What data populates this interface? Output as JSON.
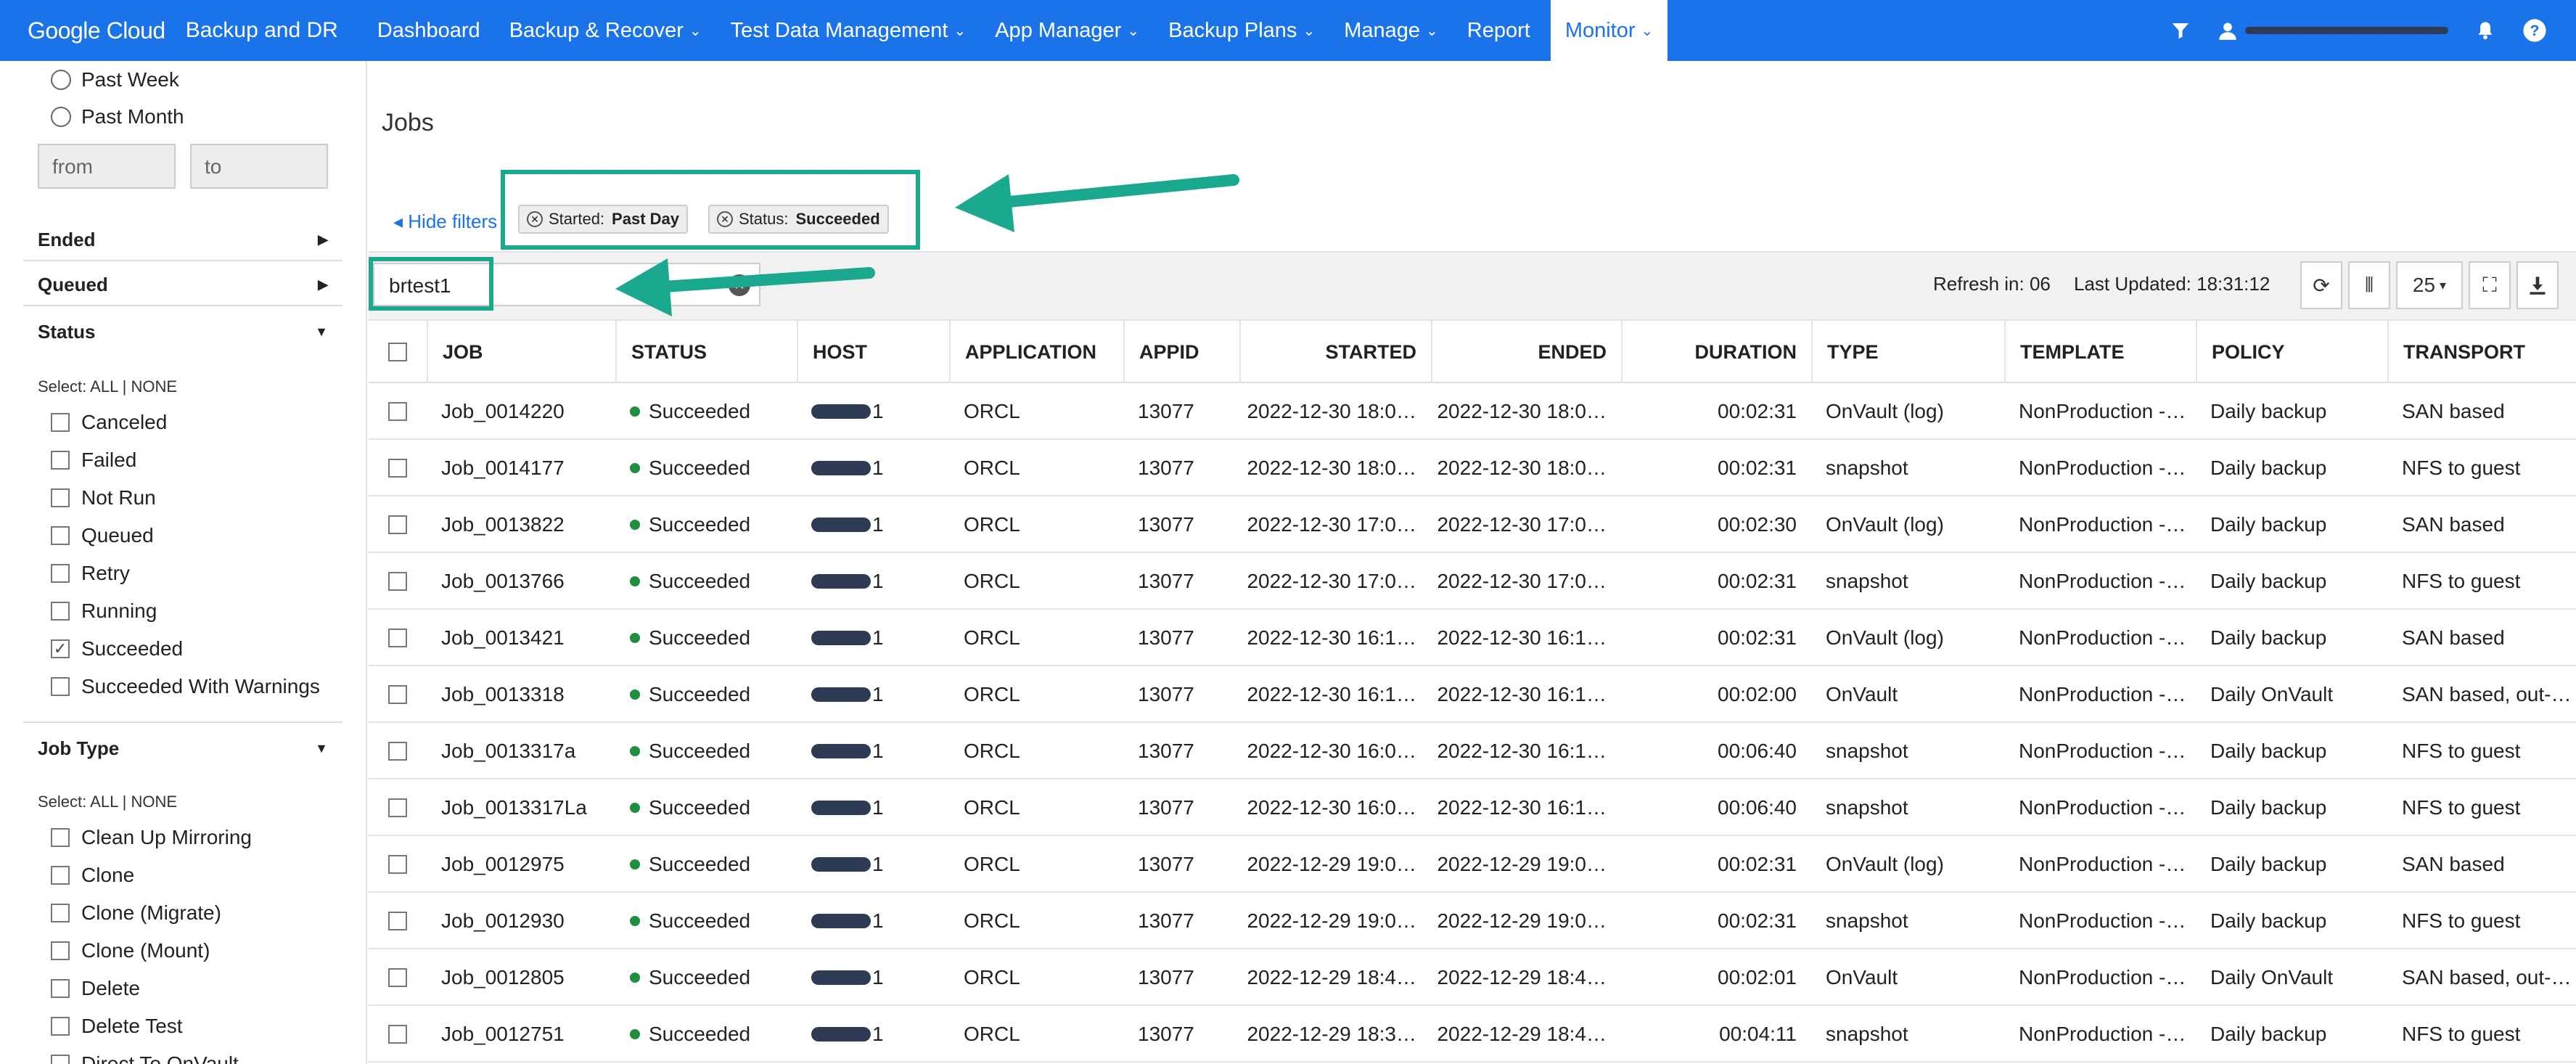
{
  "brand": {
    "company": "Google Cloud",
    "app": "Backup and DR"
  },
  "nav": [
    {
      "label": "Dashboard",
      "chevron": false
    },
    {
      "label": "Backup & Recover",
      "chevron": true
    },
    {
      "label": "Test Data Management",
      "chevron": true
    },
    {
      "label": "App Manager",
      "chevron": true
    },
    {
      "label": "Backup Plans",
      "chevron": true
    },
    {
      "label": "Manage",
      "chevron": true
    },
    {
      "label": "Report",
      "chevron": false
    },
    {
      "label": "Monitor",
      "chevron": true,
      "active": true
    }
  ],
  "sidebar": {
    "radios": [
      "Past Week",
      "Past Month"
    ],
    "from_placeholder": "from",
    "to_placeholder": "to",
    "ended": "Ended",
    "queued": "Queued",
    "status": "Status",
    "select_prefix": "Select:",
    "all": "ALL",
    "sep": "|",
    "none": "NONE",
    "status_items": [
      {
        "label": "Canceled",
        "checked": false
      },
      {
        "label": "Failed",
        "checked": false
      },
      {
        "label": "Not Run",
        "checked": false
      },
      {
        "label": "Queued",
        "checked": false
      },
      {
        "label": "Retry",
        "checked": false
      },
      {
        "label": "Running",
        "checked": false
      },
      {
        "label": "Succeeded",
        "checked": true
      },
      {
        "label": "Succeeded With Warnings",
        "checked": false
      }
    ],
    "job_type": "Job Type",
    "job_type_items": [
      {
        "label": "Clean Up Mirroring",
        "checked": false
      },
      {
        "label": "Clone",
        "checked": false
      },
      {
        "label": "Clone (Migrate)",
        "checked": false
      },
      {
        "label": "Clone (Mount)",
        "checked": false
      },
      {
        "label": "Delete",
        "checked": false
      },
      {
        "label": "Delete Test",
        "checked": false
      },
      {
        "label": "Direct To OnVault",
        "checked": false
      }
    ]
  },
  "main": {
    "title": "Jobs",
    "hide_filters": "Hide filters",
    "chips": [
      {
        "key": "Started:",
        "value": "Past Day"
      },
      {
        "key": "Status:",
        "value": "Succeeded"
      }
    ],
    "search_value": "brtest1",
    "refresh": "Refresh in: 06",
    "last_updated": "Last Updated: 18:31:12",
    "page_size": "25"
  },
  "table": {
    "columns": [
      "JOB",
      "STATUS",
      "HOST",
      "APPLICATION",
      "APPID",
      "STARTED",
      "ENDED",
      "DURATION",
      "TYPE",
      "TEMPLATE",
      "POLICY",
      "TRANSPORT"
    ],
    "rows": [
      [
        "Job_0014220",
        "Succeeded",
        "1",
        "ORCL",
        "13077",
        "2022-12-30 18:0…",
        "2022-12-30 18:0…",
        "00:02:31",
        "OnVault (log)",
        "NonProduction -…",
        "Daily backup",
        "SAN based"
      ],
      [
        "Job_0014177",
        "Succeeded",
        "1",
        "ORCL",
        "13077",
        "2022-12-30 18:0…",
        "2022-12-30 18:0…",
        "00:02:31",
        "snapshot",
        "NonProduction -…",
        "Daily backup",
        "NFS to guest"
      ],
      [
        "Job_0013822",
        "Succeeded",
        "1",
        "ORCL",
        "13077",
        "2022-12-30 17:0…",
        "2022-12-30 17:0…",
        "00:02:30",
        "OnVault (log)",
        "NonProduction -…",
        "Daily backup",
        "SAN based"
      ],
      [
        "Job_0013766",
        "Succeeded",
        "1",
        "ORCL",
        "13077",
        "2022-12-30 17:0…",
        "2022-12-30 17:0…",
        "00:02:31",
        "snapshot",
        "NonProduction -…",
        "Daily backup",
        "NFS to guest"
      ],
      [
        "Job_0013421",
        "Succeeded",
        "1",
        "ORCL",
        "13077",
        "2022-12-30 16:1…",
        "2022-12-30 16:1…",
        "00:02:31",
        "OnVault (log)",
        "NonProduction -…",
        "Daily backup",
        "SAN based"
      ],
      [
        "Job_0013318",
        "Succeeded",
        "1",
        "ORCL",
        "13077",
        "2022-12-30 16:1…",
        "2022-12-30 16:1…",
        "00:02:00",
        "OnVault",
        "NonProduction -…",
        "Daily OnVault",
        "SAN based, out-…"
      ],
      [
        "Job_0013317a",
        "Succeeded",
        "1",
        "ORCL",
        "13077",
        "2022-12-30 16:0…",
        "2022-12-30 16:1…",
        "00:06:40",
        "snapshot",
        "NonProduction -…",
        "Daily backup",
        "NFS to guest"
      ],
      [
        "Job_0013317La",
        "Succeeded",
        "1",
        "ORCL",
        "13077",
        "2022-12-30 16:0…",
        "2022-12-30 16:1…",
        "00:06:40",
        "snapshot",
        "NonProduction -…",
        "Daily backup",
        "NFS to guest"
      ],
      [
        "Job_0012975",
        "Succeeded",
        "1",
        "ORCL",
        "13077",
        "2022-12-29 19:0…",
        "2022-12-29 19:0…",
        "00:02:31",
        "OnVault (log)",
        "NonProduction -…",
        "Daily backup",
        "SAN based"
      ],
      [
        "Job_0012930",
        "Succeeded",
        "1",
        "ORCL",
        "13077",
        "2022-12-29 19:0…",
        "2022-12-29 19:0…",
        "00:02:31",
        "snapshot",
        "NonProduction -…",
        "Daily backup",
        "NFS to guest"
      ],
      [
        "Job_0012805",
        "Succeeded",
        "1",
        "ORCL",
        "13077",
        "2022-12-29 18:4…",
        "2022-12-29 18:4…",
        "00:02:01",
        "OnVault",
        "NonProduction -…",
        "Daily OnVault",
        "SAN based, out-…"
      ],
      [
        "Job_0012751",
        "Succeeded",
        "1",
        "ORCL",
        "13077",
        "2022-12-29 18:3…",
        "2022-12-29 18:4…",
        "00:04:11",
        "snapshot",
        "NonProduction -…",
        "Daily backup",
        "NFS to guest"
      ]
    ]
  },
  "colors": {
    "brand_blue": "#1a73e8",
    "highlight": "#1aa88e",
    "success": "#1e8e3e"
  }
}
